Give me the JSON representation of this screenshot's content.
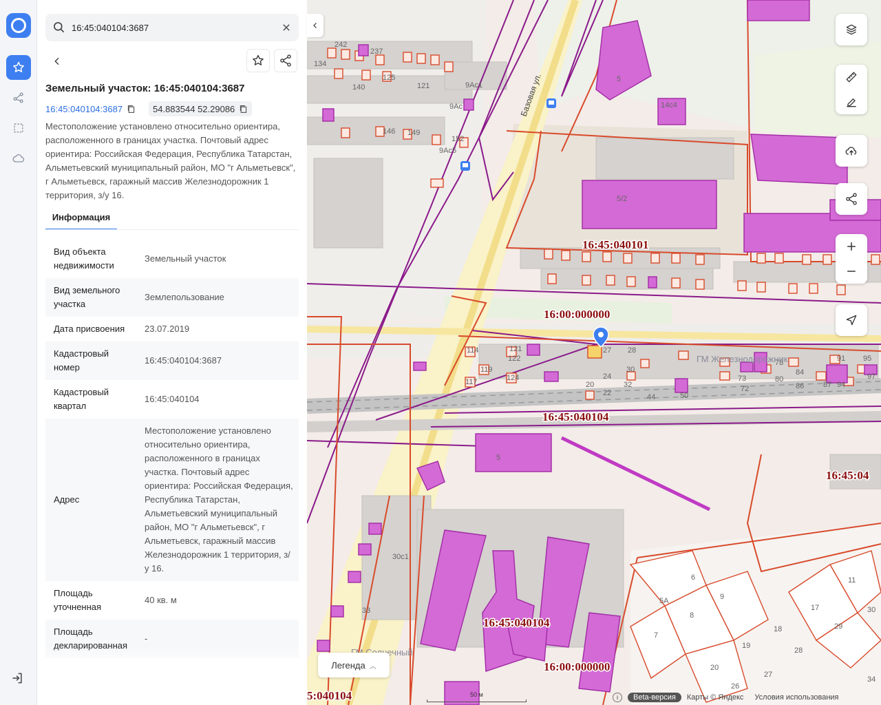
{
  "search": {
    "value": "16:45:040104:3687"
  },
  "object": {
    "title": "Земельный участок: 16:45:040104:3687",
    "cadastral_link": "16:45:040104:3687",
    "coords": "54.883544 52.29086",
    "description": "Местоположение установлено относительно ориентира, расположенного в границах участка. Почтовый адрес ориентира: Российская Федерация, Республика Татарстан, Альметьевский муниципальный район, МО \"г Альметьевск\", г Альметьевск, гаражный массив Железнодорожник 1 территория, з/у 16."
  },
  "tabs": {
    "info": "Информация"
  },
  "info_rows": [
    {
      "key": "Вид объекта недвижимости",
      "value": "Земельный участок"
    },
    {
      "key": "Вид земельного участка",
      "value": "Землепользование"
    },
    {
      "key": "Дата присвоения",
      "value": "23.07.2019"
    },
    {
      "key": "Кадастровый номер",
      "value": "16:45:040104:3687"
    },
    {
      "key": "Кадастровый квартал",
      "value": "16:45:040104"
    },
    {
      "key": "Адрес",
      "value": "Местоположение установлено относительно ориентира, расположенного в границах участка. Почтовый адрес ориентира: Российская Федерация, Республика Татарстан, Альметьевский муниципальный район, МО \"г Альметьевск\", г Альметьевск, гаражный массив Железнодорожник 1 территория, з/у 16."
    },
    {
      "key": "Площадь уточненная",
      "value": "40 кв. м"
    },
    {
      "key": "Площадь декларированная",
      "value": "-"
    }
  ],
  "map": {
    "legend_label": "Легенда",
    "scale_label": "50 м",
    "beta_label": "Beta-версия",
    "attribution": "Карты © Яндекс",
    "terms": "Условия использования",
    "labels": {
      "street": "Базовая ул.",
      "gm_zhd": "ГМ Железнодорожник",
      "gm_sol": "ГМ Солнечный",
      "q_040101": "16:45:040101",
      "q_000000_top": "16:00:000000",
      "q_040104_mid": "16:45:040104",
      "q_040104_low": "16:45:040104",
      "q_000000_low": "16:00:000000",
      "q_04_right": "16:45:04",
      "q_040104_left": "5:040104"
    },
    "numbers": {
      "n5_top": "5",
      "n14c4": "14с4",
      "n52": "5/2",
      "n5_mid": "5",
      "n30c1": "30с1",
      "n33": "33",
      "n27": "27",
      "n28": "28",
      "n24": "24",
      "n30": "30",
      "n32": "32",
      "n20": "20",
      "n22": "22",
      "n114": "114",
      "n121": "121",
      "n122": "122",
      "n119": "119",
      "n124": "124",
      "n117": "117",
      "n242": "242",
      "n237": "237",
      "n134": "134",
      "n140": "140",
      "n121b": "121",
      "n125": "125",
      "n146": "146",
      "n149": "149",
      "n152": "152",
      "n9ac1": "9Ас1",
      "n9ac": "9Ас",
      "n9ac5": "9Ас5",
      "n6": "6",
      "n9": "9",
      "n8": "8",
      "n5a": "5А",
      "n7": "7",
      "n19": "19",
      "n18": "18",
      "n28b": "28",
      "n20b": "20",
      "n27b": "27",
      "n17": "17",
      "n11": "11",
      "n29": "29",
      "n30b": "30",
      "n26": "26",
      "n34": "34",
      "n73": "73",
      "n72": "72",
      "n78": "78",
      "n80": "80",
      "n84": "84",
      "n86": "86",
      "n87": "87",
      "n91": "91",
      "n94": "94",
      "n95": "95",
      "n97": "97",
      "n44": "44",
      "n50": "50"
    }
  },
  "colors": {
    "accent": "#3d7ff0",
    "parcel": "#d84a2b",
    "building": "#d46ad6",
    "boundary": "#8a1a8a"
  }
}
